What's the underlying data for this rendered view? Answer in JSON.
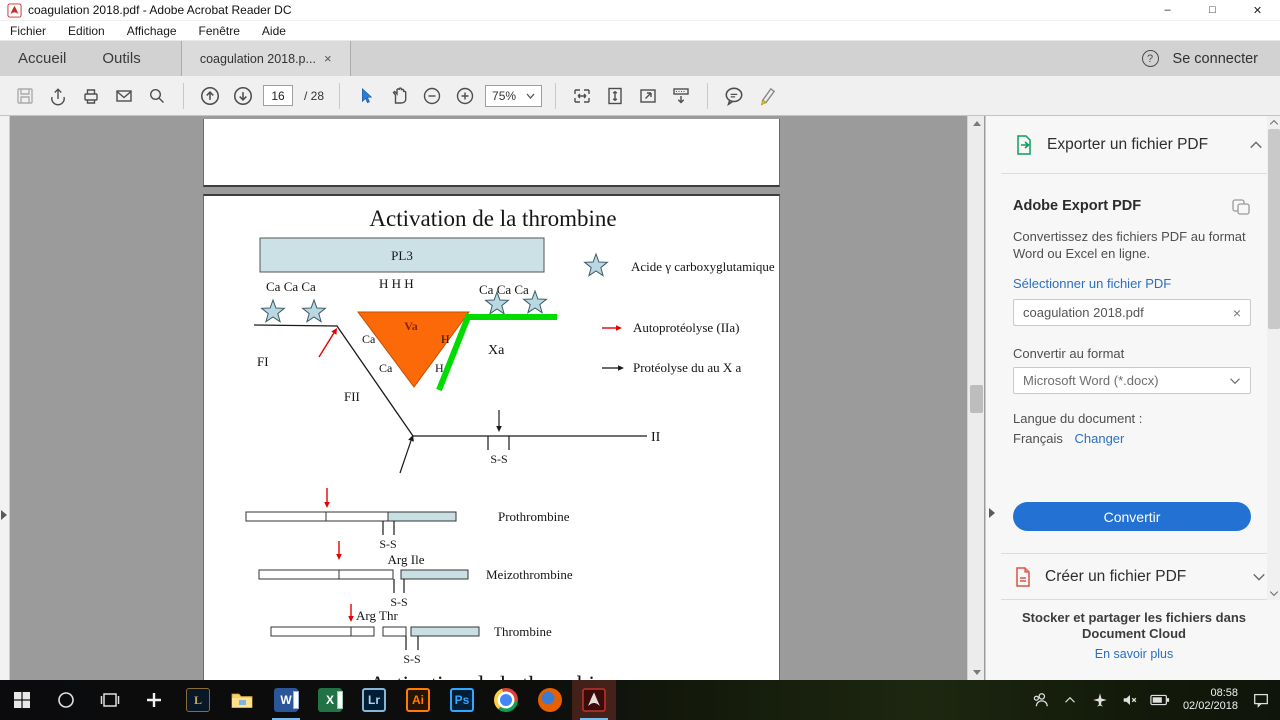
{
  "colors": {
    "accent_blue": "#2471d4",
    "link_blue": "#2b70c0",
    "doc_gray": "#9b9b9b",
    "star_fill": "#b9d8e1",
    "bar_fill": "#c8e0e4",
    "triangle_orange": "#fb6909",
    "green_line": "#00dc00",
    "arrow_red": "#e60000",
    "export_green": "#0d9e5f",
    "create_red": "#d9534a",
    "cursor_blue": "#2e7cd6"
  },
  "window": {
    "title": "coagulation 2018.pdf - Adobe Acrobat Reader DC",
    "min": "–",
    "max": "□",
    "close": "✕"
  },
  "menu": {
    "items": [
      "Fichier",
      "Edition",
      "Affichage",
      "Fenêtre",
      "Aide"
    ]
  },
  "tabs": {
    "accueil": "Accueil",
    "outils": "Outils",
    "doc": "coagulation 2018.p...",
    "close": "×",
    "help": "?",
    "sign_in": "Se connecter"
  },
  "toolbar": {
    "page_current": "16",
    "page_total": "/ 28",
    "zoom": "75%"
  },
  "pdf": {
    "title": "Activation de la thrombine",
    "pl3": "PL3",
    "ca_left": "Ca Ca Ca",
    "hhh": "H H H",
    "ca_right": "Ca Ca Ca",
    "legend_star": "Acide γ carboxyglutamique",
    "legend_auto": "Autoprotéolyse (IIa)",
    "legend_proteo": "Protéolyse du au X a",
    "fi": "FI",
    "fii": "FII",
    "ii": "II",
    "va": "Va",
    "xa": "Xa",
    "ca_a": "Ca",
    "ca_b": "Ca",
    "h_a": "H",
    "h_b": "H",
    "ss": "S-S",
    "prothrombine": "Prothrombine",
    "arg_ile": "Arg Ile",
    "meizothrombine": "Meizothrombine",
    "arg_thr": "Arg Thr",
    "thrombine": "Thrombine",
    "title_next": "Activation de la thrombine"
  },
  "panel": {
    "header": "Exporter un fichier PDF",
    "section_title": "Adobe Export PDF",
    "description": "Convertissez des fichiers PDF au format Word ou Excel en ligne.",
    "select_link": "Sélectionner un fichier PDF",
    "file_name": "coagulation 2018.pdf",
    "file_clear": "×",
    "format_label": "Convertir au format",
    "format_value": "Microsoft Word (*.docx)",
    "language_label": "Langue du document :",
    "language_value": "Français",
    "change_link": "Changer",
    "convert": "Convertir",
    "create": "Créer un fichier PDF",
    "footer_title": "Stocker et partager les fichiers dans Document Cloud",
    "footer_link": "En savoir plus"
  },
  "taskbar": {
    "lol": "L",
    "word": "W",
    "excel": "X",
    "lightroom": "Lr",
    "illustrator": "Ai",
    "photoshop": "Ps",
    "time": "08:58",
    "date": "02/02/2018"
  }
}
